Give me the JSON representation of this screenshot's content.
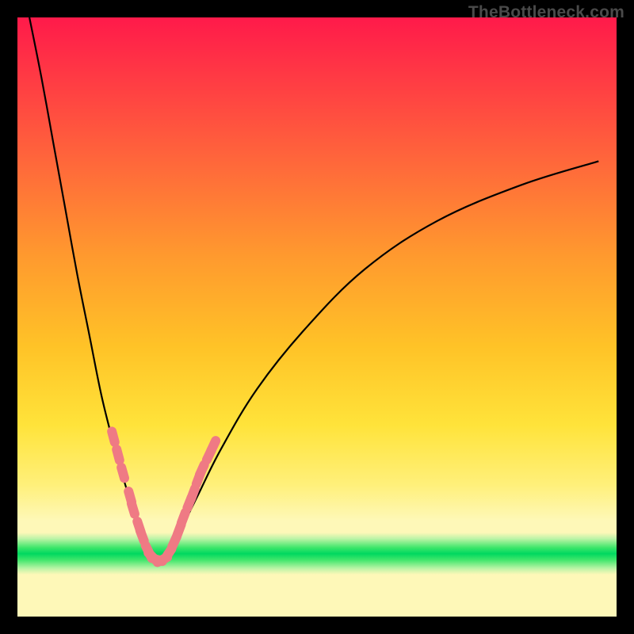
{
  "watermark": "TheBottleneck.com",
  "chart_data": {
    "type": "line",
    "title": "",
    "xlabel": "",
    "ylabel": "",
    "xlim": [
      0,
      100
    ],
    "ylim": [
      0,
      100
    ],
    "grid": false,
    "legend": false,
    "background_gradient": {
      "stops": [
        {
          "pos": 0.0,
          "color": "#ff1a4a"
        },
        {
          "pos": 0.25,
          "color": "#ff6a3a"
        },
        {
          "pos": 0.55,
          "color": "#ffc327"
        },
        {
          "pos": 0.78,
          "color": "#fff07a"
        },
        {
          "pos": 0.86,
          "color": "#fef8b8"
        },
        {
          "pos": 0.895,
          "color": "#00d860"
        },
        {
          "pos": 0.93,
          "color": "#fef8b8"
        },
        {
          "pos": 1.0,
          "color": "#fef8b8"
        }
      ]
    },
    "series": [
      {
        "name": "left-branch",
        "x": [
          2,
          4,
          6,
          8,
          10,
          12,
          14,
          16,
          18,
          20,
          21,
          22,
          23,
          23.8
        ],
        "y": [
          100,
          90,
          79,
          68,
          57,
          47,
          37,
          29,
          22,
          16,
          13,
          10.5,
          9.5,
          9.5
        ]
      },
      {
        "name": "right-branch",
        "x": [
          23.8,
          25,
          27,
          30,
          34,
          40,
          48,
          58,
          70,
          84,
          97
        ],
        "y": [
          9.5,
          10.5,
          14,
          20,
          28,
          38,
          48,
          58,
          66,
          72,
          76
        ]
      }
    ],
    "markers": {
      "name": "highlight-cluster",
      "color": "#ef7a84",
      "points": [
        {
          "x": 16.0,
          "y": 30.0
        },
        {
          "x": 16.8,
          "y": 27.0
        },
        {
          "x": 17.6,
          "y": 24.0
        },
        {
          "x": 18.8,
          "y": 20.0
        },
        {
          "x": 19.3,
          "y": 18.0
        },
        {
          "x": 20.3,
          "y": 15.0
        },
        {
          "x": 20.8,
          "y": 13.5
        },
        {
          "x": 21.8,
          "y": 11.0
        },
        {
          "x": 22.5,
          "y": 10.0
        },
        {
          "x": 23.3,
          "y": 9.5
        },
        {
          "x": 24.2,
          "y": 9.5
        },
        {
          "x": 25.2,
          "y": 10.5
        },
        {
          "x": 26.2,
          "y": 12.5
        },
        {
          "x": 27.0,
          "y": 14.5
        },
        {
          "x": 27.7,
          "y": 16.5
        },
        {
          "x": 28.7,
          "y": 19.0
        },
        {
          "x": 29.3,
          "y": 20.5
        },
        {
          "x": 30.2,
          "y": 23.0
        },
        {
          "x": 30.8,
          "y": 24.5
        },
        {
          "x": 32.0,
          "y": 27.0
        },
        {
          "x": 32.7,
          "y": 28.5
        }
      ]
    }
  }
}
